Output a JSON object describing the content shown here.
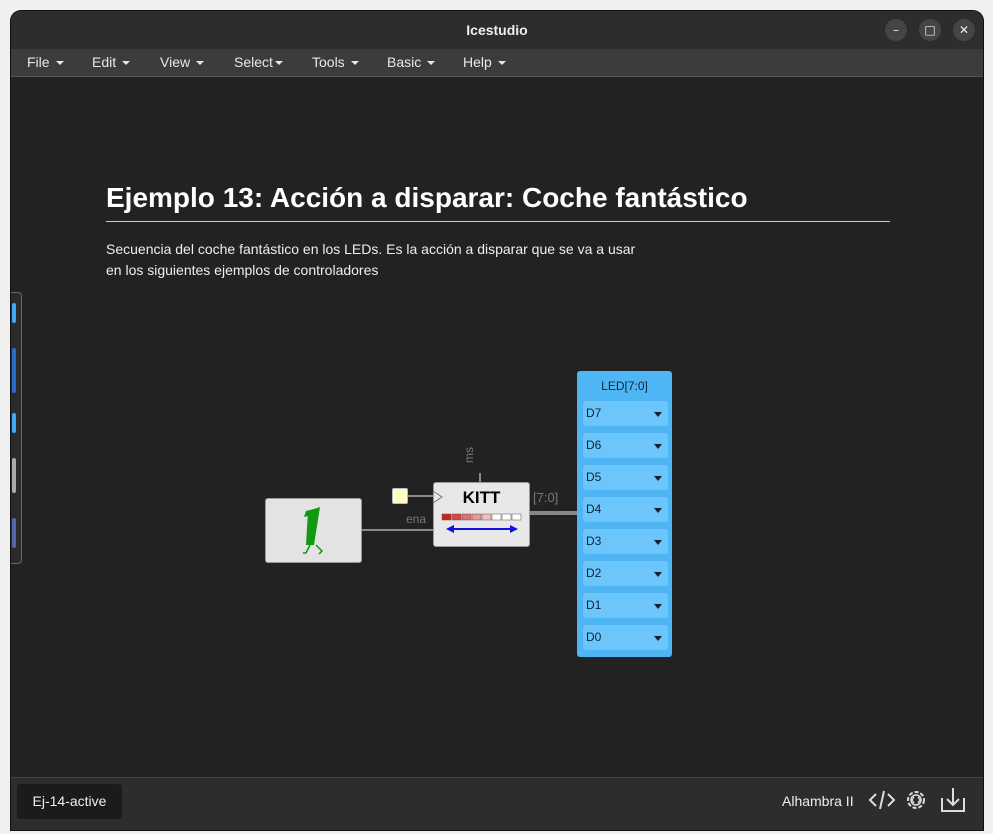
{
  "window": {
    "title": "Icestudio"
  },
  "window_controls": {
    "minimize": "–",
    "maximize": "□",
    "close": "✕"
  },
  "menus": [
    {
      "label": "File"
    },
    {
      "label": "Edit"
    },
    {
      "label": "View"
    },
    {
      "label": "Select"
    },
    {
      "label": "Tools"
    },
    {
      "label": "Basic"
    },
    {
      "label": "Help"
    }
  ],
  "doc": {
    "title": "Ejemplo 13: Acción a disparar: Coche fantástico",
    "line1": "Secuencia del coche fantástico en los LEDs. Es la acción a disparar que se va a usar",
    "line2": "en los siguientes ejemplos de controladores"
  },
  "circuit": {
    "kitt_label": "KITT",
    "ena_label": "ena",
    "ms_label": "ms",
    "bus_label": "[7:0]",
    "led_header": "LED[7:0]",
    "leds": [
      "D7",
      "D6",
      "D5",
      "D4",
      "D3",
      "D2",
      "D1",
      "D0"
    ],
    "colors": {
      "led_panel": "#4fb6f6",
      "wire": "#888888",
      "const_green": "#119911",
      "arrow_blue": "#1111dd",
      "bar_red": "#cc2222"
    }
  },
  "status": {
    "tab": "Ej-14-active",
    "board": "Alhambra II",
    "icons": [
      "code-icon",
      "settings-gear-icon",
      "download-icon"
    ]
  }
}
